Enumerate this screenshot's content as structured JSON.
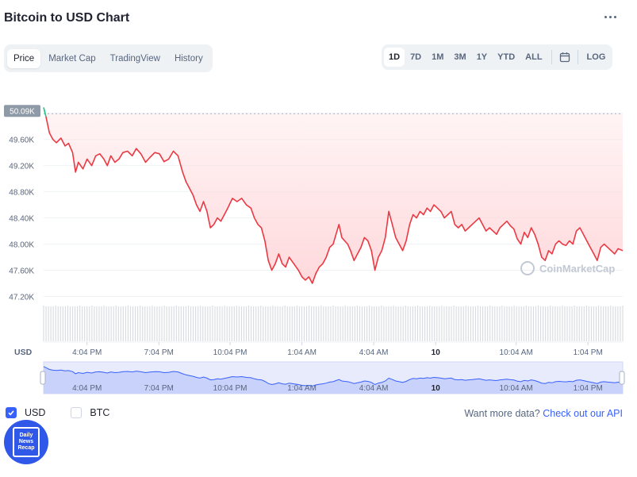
{
  "header": {
    "title": "Bitcoin to USD Chart"
  },
  "tabs": [
    {
      "label": "Price",
      "active": true
    },
    {
      "label": "Market Cap",
      "active": false
    },
    {
      "label": "TradingView",
      "active": false
    },
    {
      "label": "History",
      "active": false
    }
  ],
  "ranges": [
    {
      "label": "1D",
      "active": true
    },
    {
      "label": "7D",
      "active": false
    },
    {
      "label": "1M",
      "active": false
    },
    {
      "label": "3M",
      "active": false
    },
    {
      "label": "1Y",
      "active": false
    },
    {
      "label": "YTD",
      "active": false
    },
    {
      "label": "ALL",
      "active": false
    }
  ],
  "log_label": "LOG",
  "chart_data": {
    "type": "line",
    "currency_label": "USD",
    "current_price_label": "50.09K",
    "watermark": "CoinMarketCap",
    "ylim": [
      47000,
      50300
    ],
    "yticks": [
      {
        "value": 50000,
        "label": "50.00K"
      },
      {
        "value": 49600,
        "label": "49.60K"
      },
      {
        "value": 49200,
        "label": "49.20K"
      },
      {
        "value": 48800,
        "label": "48.80K"
      },
      {
        "value": 48400,
        "label": "48.40K"
      },
      {
        "value": 48000,
        "label": "48.00K"
      },
      {
        "value": 47600,
        "label": "47.60K"
      },
      {
        "value": 47200,
        "label": "47.20K"
      }
    ],
    "xticks": [
      {
        "t": 0.075,
        "label": "4:04 PM",
        "bold": false
      },
      {
        "t": 0.199,
        "label": "7:04 PM",
        "bold": false
      },
      {
        "t": 0.322,
        "label": "10:04 PM",
        "bold": false
      },
      {
        "t": 0.446,
        "label": "1:04 AM",
        "bold": false
      },
      {
        "t": 0.57,
        "label": "4:04 AM",
        "bold": false
      },
      {
        "t": 0.677,
        "label": "10",
        "bold": true
      },
      {
        "t": 0.816,
        "label": "10:04 AM",
        "bold": false
      },
      {
        "t": 0.94,
        "label": "1:04 PM",
        "bold": false
      }
    ],
    "x_domain": [
      0,
      1
    ],
    "series": [
      {
        "values": [
          [
            0.0,
            50090
          ],
          [
            0.004,
            49950
          ],
          [
            0.01,
            49700
          ],
          [
            0.016,
            49600
          ],
          [
            0.022,
            49550
          ],
          [
            0.03,
            49620
          ],
          [
            0.037,
            49500
          ],
          [
            0.043,
            49540
          ],
          [
            0.05,
            49400
          ],
          [
            0.055,
            49100
          ],
          [
            0.06,
            49250
          ],
          [
            0.068,
            49150
          ],
          [
            0.075,
            49300
          ],
          [
            0.083,
            49200
          ],
          [
            0.09,
            49350
          ],
          [
            0.097,
            49380
          ],
          [
            0.104,
            49300
          ],
          [
            0.11,
            49200
          ],
          [
            0.116,
            49350
          ],
          [
            0.123,
            49250
          ],
          [
            0.13,
            49300
          ],
          [
            0.137,
            49400
          ],
          [
            0.145,
            49420
          ],
          [
            0.153,
            49350
          ],
          [
            0.16,
            49460
          ],
          [
            0.168,
            49380
          ],
          [
            0.176,
            49250
          ],
          [
            0.184,
            49330
          ],
          [
            0.192,
            49400
          ],
          [
            0.2,
            49380
          ],
          [
            0.208,
            49260
          ],
          [
            0.216,
            49300
          ],
          [
            0.224,
            49420
          ],
          [
            0.232,
            49350
          ],
          [
            0.24,
            49100
          ],
          [
            0.246,
            48950
          ],
          [
            0.252,
            48850
          ],
          [
            0.258,
            48750
          ],
          [
            0.264,
            48600
          ],
          [
            0.27,
            48500
          ],
          [
            0.276,
            48650
          ],
          [
            0.282,
            48500
          ],
          [
            0.288,
            48250
          ],
          [
            0.294,
            48300
          ],
          [
            0.3,
            48400
          ],
          [
            0.306,
            48350
          ],
          [
            0.312,
            48450
          ],
          [
            0.318,
            48550
          ],
          [
            0.326,
            48700
          ],
          [
            0.334,
            48650
          ],
          [
            0.342,
            48700
          ],
          [
            0.35,
            48600
          ],
          [
            0.358,
            48550
          ],
          [
            0.364,
            48400
          ],
          [
            0.37,
            48300
          ],
          [
            0.376,
            48250
          ],
          [
            0.382,
            48050
          ],
          [
            0.388,
            47750
          ],
          [
            0.394,
            47600
          ],
          [
            0.4,
            47700
          ],
          [
            0.406,
            47850
          ],
          [
            0.412,
            47700
          ],
          [
            0.418,
            47650
          ],
          [
            0.424,
            47800
          ],
          [
            0.432,
            47700
          ],
          [
            0.44,
            47600
          ],
          [
            0.446,
            47500
          ],
          [
            0.452,
            47450
          ],
          [
            0.458,
            47500
          ],
          [
            0.464,
            47400
          ],
          [
            0.47,
            47550
          ],
          [
            0.476,
            47650
          ],
          [
            0.482,
            47700
          ],
          [
            0.488,
            47800
          ],
          [
            0.494,
            47950
          ],
          [
            0.5,
            48000
          ],
          [
            0.505,
            48150
          ],
          [
            0.51,
            48300
          ],
          [
            0.515,
            48100
          ],
          [
            0.52,
            48050
          ],
          [
            0.525,
            48000
          ],
          [
            0.53,
            47900
          ],
          [
            0.536,
            47750
          ],
          [
            0.542,
            47850
          ],
          [
            0.548,
            47950
          ],
          [
            0.554,
            48100
          ],
          [
            0.56,
            48050
          ],
          [
            0.566,
            47900
          ],
          [
            0.572,
            47600
          ],
          [
            0.578,
            47800
          ],
          [
            0.584,
            47900
          ],
          [
            0.59,
            48100
          ],
          [
            0.596,
            48500
          ],
          [
            0.602,
            48300
          ],
          [
            0.608,
            48100
          ],
          [
            0.614,
            48000
          ],
          [
            0.62,
            47900
          ],
          [
            0.626,
            48050
          ],
          [
            0.632,
            48300
          ],
          [
            0.638,
            48450
          ],
          [
            0.644,
            48400
          ],
          [
            0.65,
            48500
          ],
          [
            0.656,
            48450
          ],
          [
            0.662,
            48550
          ],
          [
            0.668,
            48500
          ],
          [
            0.674,
            48600
          ],
          [
            0.68,
            48550
          ],
          [
            0.686,
            48500
          ],
          [
            0.692,
            48400
          ],
          [
            0.698,
            48450
          ],
          [
            0.704,
            48500
          ],
          [
            0.71,
            48300
          ],
          [
            0.716,
            48250
          ],
          [
            0.722,
            48300
          ],
          [
            0.728,
            48200
          ],
          [
            0.734,
            48250
          ],
          [
            0.74,
            48300
          ],
          [
            0.746,
            48350
          ],
          [
            0.752,
            48400
          ],
          [
            0.758,
            48300
          ],
          [
            0.764,
            48200
          ],
          [
            0.77,
            48250
          ],
          [
            0.776,
            48200
          ],
          [
            0.782,
            48150
          ],
          [
            0.788,
            48250
          ],
          [
            0.794,
            48300
          ],
          [
            0.8,
            48350
          ],
          [
            0.806,
            48280
          ],
          [
            0.812,
            48230
          ],
          [
            0.818,
            48080
          ],
          [
            0.824,
            48000
          ],
          [
            0.83,
            48180
          ],
          [
            0.836,
            48100
          ],
          [
            0.842,
            48250
          ],
          [
            0.848,
            48150
          ],
          [
            0.854,
            48000
          ],
          [
            0.86,
            47800
          ],
          [
            0.866,
            47750
          ],
          [
            0.872,
            47900
          ],
          [
            0.878,
            47850
          ],
          [
            0.884,
            48000
          ],
          [
            0.89,
            48050
          ],
          [
            0.896,
            48000
          ],
          [
            0.902,
            47980
          ],
          [
            0.908,
            48050
          ],
          [
            0.914,
            48000
          ],
          [
            0.92,
            48200
          ],
          [
            0.926,
            48250
          ],
          [
            0.932,
            48150
          ],
          [
            0.938,
            48050
          ],
          [
            0.944,
            47950
          ],
          [
            0.95,
            47850
          ],
          [
            0.956,
            47750
          ],
          [
            0.962,
            47950
          ],
          [
            0.968,
            48000
          ],
          [
            0.974,
            47950
          ],
          [
            0.98,
            47900
          ],
          [
            0.986,
            47850
          ],
          [
            0.992,
            47930
          ],
          [
            1.0,
            47900
          ]
        ]
      }
    ],
    "color_line": "#ea3943",
    "color_up": "#16c784",
    "color_nav": "#3861fb",
    "color_fill": "#ffd7da"
  },
  "footer": {
    "usd_label": "USD",
    "btc_label": "BTC",
    "api_prefix": "Want more data?",
    "api_link": "Check out our API"
  },
  "badge": {
    "text": "Daily News Recap"
  }
}
